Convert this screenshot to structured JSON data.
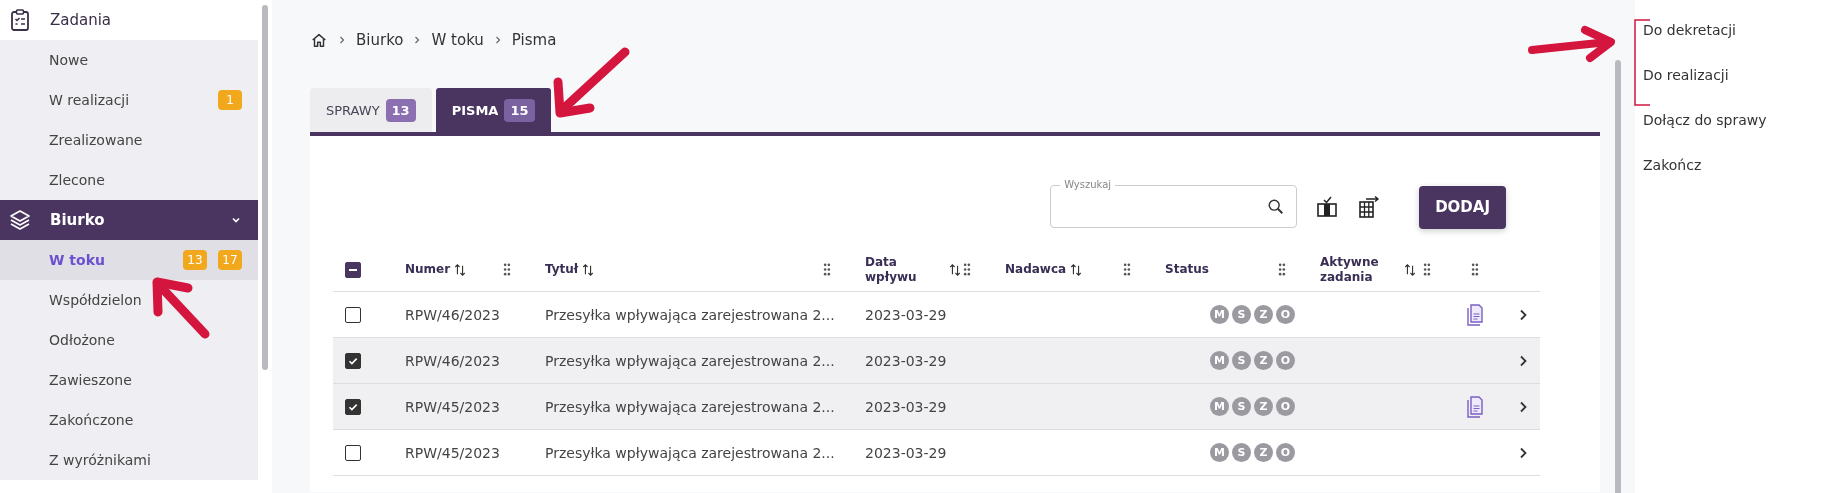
{
  "sidebar": {
    "groups": [
      {
        "label": "Zadania",
        "selected": false,
        "items": [
          {
            "label": "Nowe",
            "selected": false
          },
          {
            "label": "W realizacji",
            "selected": false,
            "badges": [
              "1"
            ]
          },
          {
            "label": "Zrealizowane",
            "selected": false
          },
          {
            "label": "Zlecone",
            "selected": false
          }
        ]
      },
      {
        "label": "Biurko",
        "selected": true,
        "expanded": true,
        "items": [
          {
            "label": "W toku",
            "selected": true,
            "badges": [
              "13",
              "17"
            ]
          },
          {
            "label": "Współdzielon",
            "selected": false
          },
          {
            "label": "Odłożone",
            "selected": false
          },
          {
            "label": "Zawieszone",
            "selected": false
          },
          {
            "label": "Zakończone",
            "selected": false
          },
          {
            "label": "Z wyróżnikami",
            "selected": false
          }
        ]
      }
    ]
  },
  "breadcrumb": [
    "Biurko",
    "W toku",
    "Pisma"
  ],
  "tabs": [
    {
      "label": "SPRAWY",
      "count": "13",
      "selected": false
    },
    {
      "label": "PISMA",
      "count": "15",
      "selected": true
    }
  ],
  "search": {
    "label": "Wyszukaj"
  },
  "add_button": "DODAJ",
  "table": {
    "select_all": {
      "indeterminate": true
    },
    "columns": [
      {
        "label": "Numer",
        "sortable": true
      },
      {
        "label": "Tytuł",
        "sortable": true
      },
      {
        "label": "Data wpływu",
        "sortable": true
      },
      {
        "label": "Nadawca",
        "sortable": true
      },
      {
        "label": "Status",
        "sortable": false
      },
      {
        "label": "Aktywne zadania",
        "sortable": true
      }
    ],
    "rows": [
      {
        "checked": false,
        "number": "RPW/46/2023",
        "title": "Przesyłka wpływająca zarejestrowana 2...",
        "date": "2023-03-29",
        "status": [
          "M",
          "S",
          "Z",
          "O"
        ],
        "document": true
      },
      {
        "checked": true,
        "number": "RPW/46/2023",
        "title": "Przesyłka wpływająca zarejestrowana 2...",
        "date": "2023-03-29",
        "status": [
          "M",
          "S",
          "Z",
          "O"
        ],
        "document": false
      },
      {
        "checked": true,
        "number": "RPW/45/2023",
        "title": "Przesyłka wpływająca zarejestrowana 2...",
        "date": "2023-03-29",
        "status": [
          "M",
          "S",
          "Z",
          "O"
        ],
        "document": true
      },
      {
        "checked": false,
        "number": "RPW/45/2023",
        "title": "Przesyłka wpływająca zarejestrowana 2...",
        "date": "2023-03-29",
        "status": [
          "M",
          "S",
          "Z",
          "O"
        ],
        "document": false
      }
    ]
  },
  "actions": [
    "Do dekretacji",
    "Do realizacji",
    "Dołącz do sprawy",
    "Zakończ"
  ]
}
